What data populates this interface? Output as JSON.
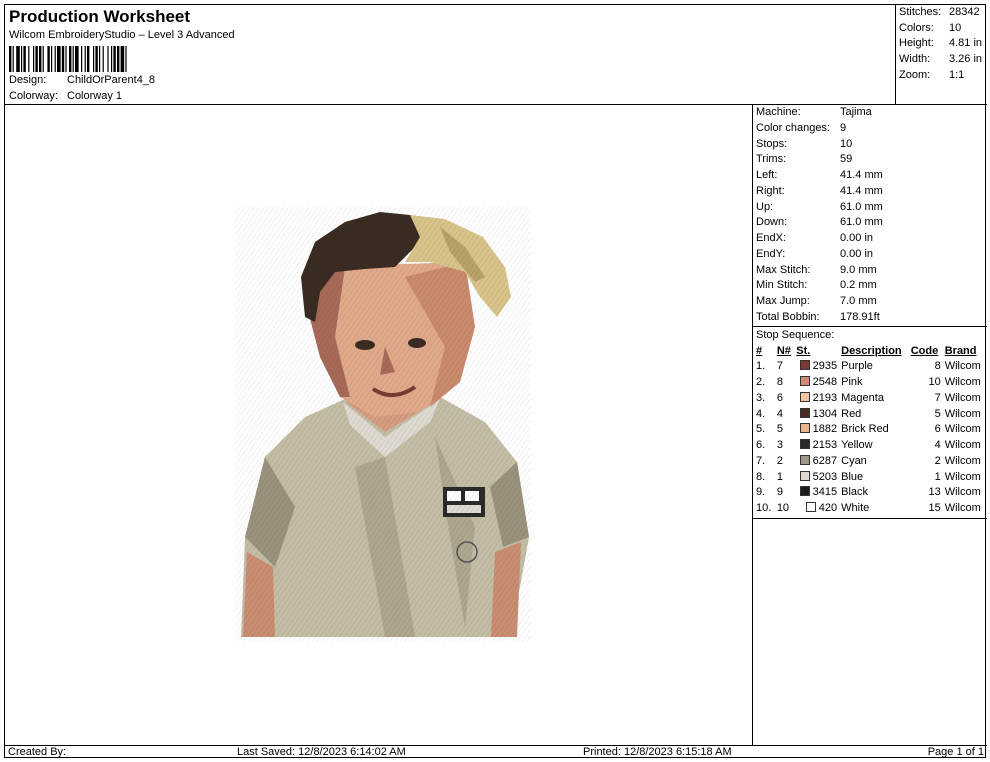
{
  "header": {
    "title": "Production Worksheet",
    "subtitle": "Wilcom EmbroideryStudio – Level 3 Advanced",
    "design_label": "Design:",
    "design_value": "ChildOrParent4_8",
    "colorway_label": "Colorway:",
    "colorway_value": "Colorway 1"
  },
  "stats": [
    {
      "label": "Stitches:",
      "value": "28342"
    },
    {
      "label": "Colors:",
      "value": "10"
    },
    {
      "label": "Height:",
      "value": "4.81 in"
    },
    {
      "label": "Width:",
      "value": "3.26 in"
    },
    {
      "label": "Zoom:",
      "value": "1:1"
    }
  ],
  "machine_info": [
    {
      "label": "Machine:",
      "value": "Tajima"
    },
    {
      "label": "Color changes:",
      "value": "9"
    },
    {
      "label": "Stops:",
      "value": "10"
    },
    {
      "label": "Trims:",
      "value": "59"
    },
    {
      "label": "Left:",
      "value": "41.4 mm"
    },
    {
      "label": "Right:",
      "value": "41.4 mm"
    },
    {
      "label": "Up:",
      "value": "61.0 mm"
    },
    {
      "label": "Down:",
      "value": "61.0 mm"
    },
    {
      "label": "EndX:",
      "value": "0.00 in"
    },
    {
      "label": "EndY:",
      "value": "0.00 in"
    },
    {
      "label": "Max Stitch:",
      "value": "9.0 mm"
    },
    {
      "label": "Min Stitch:",
      "value": "0.2 mm"
    },
    {
      "label": "Max Jump:",
      "value": "7.0 mm"
    },
    {
      "label": "Total Bobbin:",
      "value": "178.91ft"
    }
  ],
  "stop_sequence": {
    "title": "Stop Sequence:",
    "headers": {
      "index": "#",
      "n": "N#",
      "st": "St.",
      "description": "Description",
      "code": "Code",
      "brand": "Brand"
    },
    "rows": [
      {
        "index": "1.",
        "n": "7",
        "swatch": "#7a3a34",
        "st": "2935",
        "description": "Purple",
        "code": "8",
        "brand": "Wilcom"
      },
      {
        "index": "2.",
        "n": "8",
        "swatch": "#cf8a78",
        "st": "2548",
        "description": "Pink",
        "code": "10",
        "brand": "Wilcom"
      },
      {
        "index": "3.",
        "n": "6",
        "swatch": "#f2c4a6",
        "st": "2193",
        "description": "Magenta",
        "code": "7",
        "brand": "Wilcom"
      },
      {
        "index": "4.",
        "n": "4",
        "swatch": "#4a2a26",
        "st": "1304",
        "description": "Red",
        "code": "5",
        "brand": "Wilcom"
      },
      {
        "index": "5.",
        "n": "5",
        "swatch": "#e9b48c",
        "st": "1882",
        "description": "Brick Red",
        "code": "6",
        "brand": "Wilcom"
      },
      {
        "index": "6.",
        "n": "3",
        "swatch": "#2a2a28",
        "st": "2153",
        "description": "Yellow",
        "code": "4",
        "brand": "Wilcom"
      },
      {
        "index": "7.",
        "n": "2",
        "swatch": "#9e978a",
        "st": "6287",
        "description": "Cyan",
        "code": "2",
        "brand": "Wilcom"
      },
      {
        "index": "8.",
        "n": "1",
        "swatch": "#dedad2",
        "st": "5203",
        "description": "Blue",
        "code": "1",
        "brand": "Wilcom"
      },
      {
        "index": "9.",
        "n": "9",
        "swatch": "#1e1c1a",
        "st": "3415",
        "description": "Black",
        "code": "13",
        "brand": "Wilcom"
      },
      {
        "index": "10.",
        "n": "10",
        "swatch": "#ffffff",
        "st": "420",
        "description": "White",
        "code": "15",
        "brand": "Wilcom"
      }
    ]
  },
  "footer": {
    "created_by": "Created By:",
    "last_saved": "Last Saved: 12/8/2023 6:14:02 AM",
    "printed": "Printed: 12/8/2023 6:15:18 AM",
    "page": "Page 1 of 1"
  },
  "colors": {
    "shirt": "#c4bda5",
    "shirt_shadow": "#9a927c",
    "skin": "#e0a98a",
    "skin_shadow": "#a86a58",
    "hair_dark": "#3a2c22",
    "hair_light": "#d8c48a"
  }
}
